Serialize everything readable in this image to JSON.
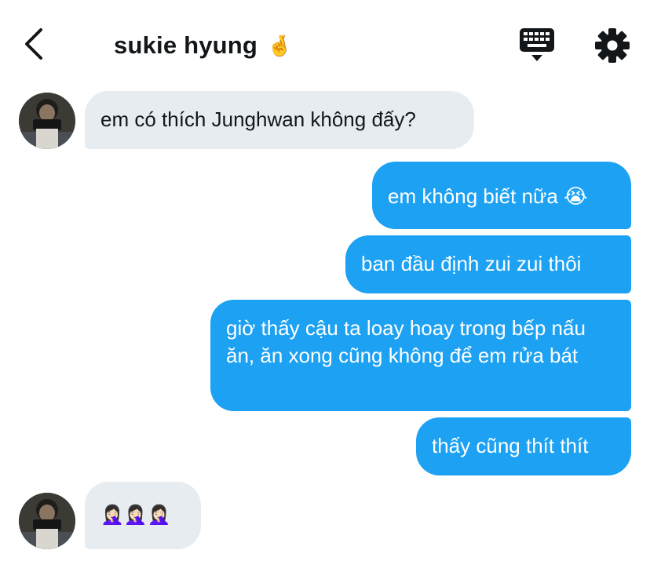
{
  "header": {
    "title": "sukie hyung",
    "title_emoji": "🤞",
    "back_icon": "chevron-left-icon",
    "keyboard_icon": "keyboard-icon",
    "settings_icon": "gear-icon"
  },
  "colors": {
    "incoming_bubble": "#e6ecf0",
    "outgoing_bubble": "#1da1f2",
    "text_dark": "#14171a",
    "text_light": "#ffffff"
  },
  "messages": [
    {
      "sender": "them",
      "text": "em có thích Junghwan không đấy?"
    },
    {
      "sender": "me",
      "text": "em không biết nữa 😭"
    },
    {
      "sender": "me",
      "text": "ban đầu định zui zui thôi"
    },
    {
      "sender": "me",
      "text": "giờ thấy cậu ta loay hoay trong bếp nấu ăn, ăn xong cũng không để em rửa bát"
    },
    {
      "sender": "me",
      "text": "thấy cũng thít thít"
    },
    {
      "sender": "them",
      "text": "🤦🏻‍♀️🤦🏻‍♀️🤦🏻‍♀️"
    }
  ]
}
